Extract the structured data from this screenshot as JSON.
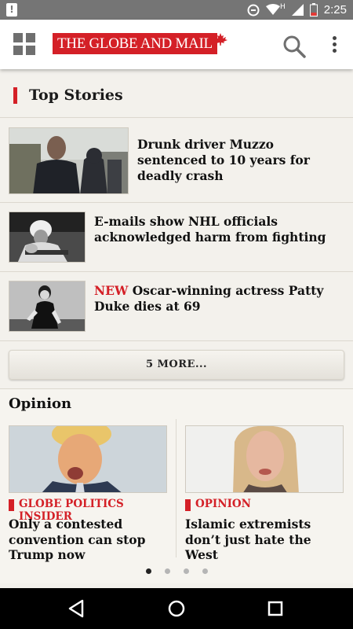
{
  "status_bar": {
    "notification_icon": "!",
    "time": "2:25",
    "icons": [
      "circle-icon",
      "wifi-icon",
      "signal-icon",
      "battery-icon"
    ],
    "network_label": "H"
  },
  "app_bar": {
    "logo_text": "THE GLOBE AND MAIL",
    "brand_color": "#d42027",
    "icons": [
      "grid-menu-icon",
      "maple-leaf-icon",
      "search-icon",
      "more-vert-icon"
    ]
  },
  "top_stories": {
    "title": "Top Stories",
    "items": [
      {
        "headline": "Drunk driver Muzzo sentenced to 10 years for deadly crash",
        "is_new": false
      },
      {
        "headline": "E-mails show NHL officials acknowledged harm from fighting",
        "is_new": false
      },
      {
        "new_label": "NEW",
        "headline": "Oscar-winning actress Patty Duke dies at 69",
        "is_new": true
      }
    ],
    "more_label": "5 MORE..."
  },
  "opinion": {
    "title": "Opinion",
    "cards": [
      {
        "kicker": "GLOBE POLITICS INSIDER",
        "headline": "Only a contested convention can stop Trump now"
      },
      {
        "kicker": "OPINION",
        "headline": "Islamic extremists don’t just hate the West"
      }
    ],
    "pager": {
      "count": 4,
      "active_index": 0
    }
  },
  "nav_bar": {
    "icons": [
      "back-icon",
      "home-icon",
      "recents-icon"
    ]
  }
}
